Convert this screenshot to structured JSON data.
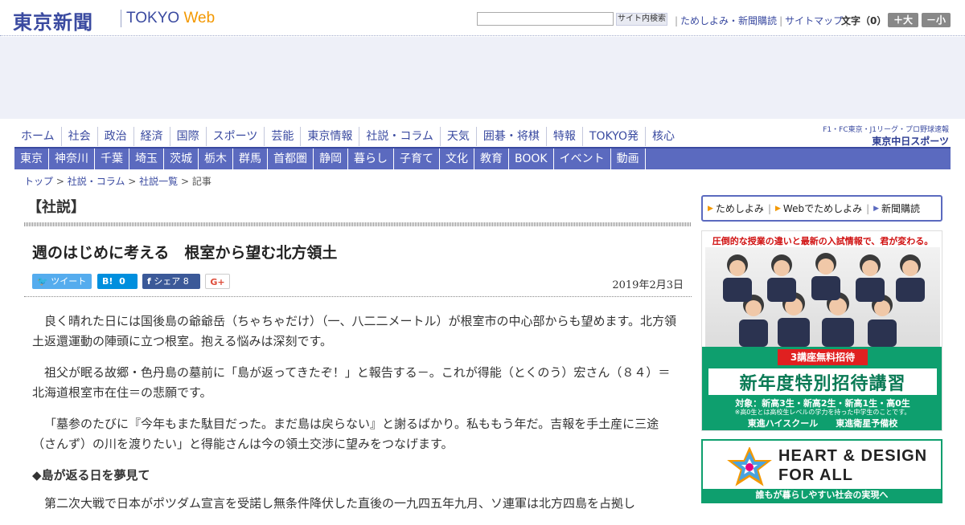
{
  "header": {
    "logo_jp": "東京新聞",
    "logo_tokyo": "TOKYO",
    "logo_web": "Web",
    "search_placeholder": "",
    "search_button": "サイト内検索",
    "links": [
      "ためしよみ・新聞購読",
      "サイトマップ"
    ],
    "font_size_label": "文字（0）",
    "font_plus": "＋大",
    "font_minus": "－小"
  },
  "nav_primary": [
    "ホーム",
    "社会",
    "政治",
    "経済",
    "国際",
    "スポーツ",
    "芸能",
    "東京情報",
    "社説・コラム",
    "天気",
    "囲碁・将棋",
    "特報",
    "TOKYO発",
    "核心"
  ],
  "chunichi": {
    "tagline": "F1・FC東京・J1リーグ・プロ野球速報",
    "name": "東京中日スポーツ"
  },
  "nav_regional": [
    "東京",
    "神奈川",
    "千葉",
    "埼玉",
    "茨城",
    "栃木",
    "群馬",
    "首都圏",
    "静岡",
    "暮らし",
    "子育て",
    "文化",
    "教育",
    "BOOK",
    "イベント",
    "動画"
  ],
  "breadcrumb": [
    "トップ",
    "社説・コラム",
    "社説一覧",
    "記事"
  ],
  "breadcrumb_sep": ">",
  "section_label": "【社説】",
  "article": {
    "title": "週のはじめに考える　根室から望む北方領土",
    "date": "2019年2月3日",
    "share": {
      "tweet": "ツイート",
      "hatena": "B!",
      "hatena_count": "0",
      "facebook": "シェア",
      "facebook_count": "8",
      "gplus": "G+"
    },
    "paragraphs": [
      "良く晴れた日には国後島の爺爺岳（ちゃちゃだけ）（一、八二二メートル）が根室市の中心部からも望めます。北方領土返還運動の陣頭に立つ根室。抱える悩みは深刻です。",
      "祖父が眠る故郷・色丹島の墓前に「島が返ってきたぞ！」と報告する－。これが得能（とくのう）宏さん（８４）＝北海道根室市在住＝の悲願です。",
      "「墓参のたびに『今年もまた駄目だった。まだ島は戻らない』と謝るばかり。私ももう年だ。吉報を手土産に三途（さんず）の川を渡りたい」と得能さんは今の領土交渉に望みをつなげます。"
    ],
    "subheading": "◆島が返る日を夢見て",
    "paragraph_after": "第二次大戦で日本がポツダム宣言を受諾し無条件降伏した直後の一九四五年九月、ソ連軍は北方四島を占拠し"
  },
  "sidebar": {
    "links": [
      "ためしよみ",
      "Webでためしよみ",
      "新聞購読"
    ],
    "ad1": {
      "headline": "圧倒的な授業の違いと最新の入試情報で、君が変わる。",
      "badge": "3講座無料招待",
      "big": "新年度特別招待講習",
      "target": "対象：新高3生・新高2生・新高1生・高0生",
      "note": "※高0生とは高校生レベルの学力を持った中学生のことです。",
      "schools": "東進ハイスクール　　東進衛星予備校"
    },
    "ad2": {
      "line1": "HEART & DESIGN",
      "line2": "FOR ALL",
      "bar": "誰もが暮らしやすい社会の実現へ"
    }
  },
  "colors": {
    "brand": "#3a4aa0",
    "nav_bg": "#5b6abf",
    "accent_orange": "#f39800",
    "green": "#0e9f6e"
  }
}
